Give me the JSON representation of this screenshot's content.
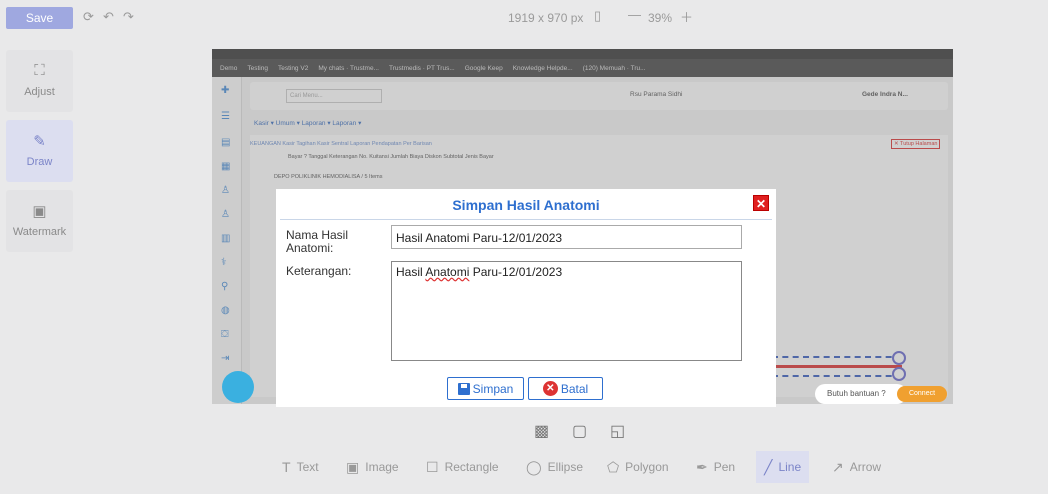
{
  "toolbar": {
    "save_label": "Save",
    "dimensions": "1919 x 970 px",
    "zoom": "39%"
  },
  "side_tools": [
    {
      "label": "Adjust",
      "icon": "crop-icon"
    },
    {
      "label": "Draw",
      "icon": "pencil-icon"
    },
    {
      "label": "Watermark",
      "icon": "image-icon"
    }
  ],
  "bookmarks": [
    "Demo",
    "Testing",
    "Testing V2",
    "My chats · Trustme...",
    "Trustmedis · PT Trus...",
    "Google Keep",
    "Knowledge Helpde...",
    "(120) Memuah · Tru..."
  ],
  "app": {
    "search_placeholder": "Cari Menu...",
    "hospital": "Rsu Parama Sidhi",
    "user": "Gede Indra N...",
    "menu": "Kasir ▾   Umum ▾   Laporan ▾   Laporan ▾",
    "crumb": "KEUANGAN   Kasir Tagihan   Kasir Sentral   Laporan Pendapatan Per Barisan",
    "columns": "Bayar ?     Tanggal         Keterangan                                     No. Kuitansi             Jumlah  Biaya           Diskon         Subtotal        Jenis Bayar",
    "row": "DEPO POLIKLINIK HEMODIALISA / 5 Items",
    "tutup": "✕ Tutup Halaman",
    "butuh_bantuan": "Butuh bantuan ?",
    "connect": "Connect"
  },
  "dialog": {
    "title": "Simpan Hasil Anatomi",
    "name_label": "Nama Hasil Anatomi:",
    "name_value": "Hasil Anatomi Paru-12/01/2023",
    "keterangan_label": "Keterangan:",
    "keterangan_pre": "Hasil ",
    "keterangan_sq": "Anatomi",
    "keterangan_post": " Paru-12/01/2023",
    "simpan_label": "Simpan",
    "batal_label": "Batal"
  },
  "bottom_tools": [
    {
      "label": "Text",
      "icon": "text-icon"
    },
    {
      "label": "Image",
      "icon": "image-icon"
    },
    {
      "label": "Rectangle",
      "icon": "rectangle-icon"
    },
    {
      "label": "Ellipse",
      "icon": "ellipse-icon"
    },
    {
      "label": "Polygon",
      "icon": "polygon-icon"
    },
    {
      "label": "Pen",
      "icon": "pen-icon"
    },
    {
      "label": "Line",
      "icon": "line-icon"
    },
    {
      "label": "Arrow",
      "icon": "arrow-icon"
    }
  ],
  "colors": {
    "accent": "#9fa8e0",
    "dialog_title": "#2e6fcf",
    "close": "#e02020"
  }
}
